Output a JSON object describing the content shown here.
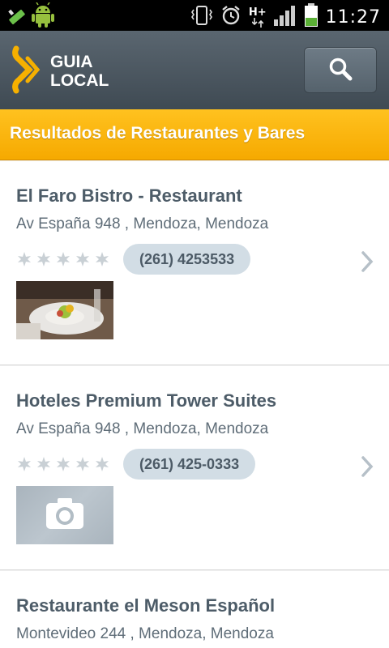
{
  "status_bar": {
    "time": "11:27",
    "network_type": "H+"
  },
  "header": {
    "logo_line1": "GUIA",
    "logo_line2": "LOCAL",
    "brand_color": "#f6a900"
  },
  "section": {
    "title": "Resultados de Restaurantes y Bares"
  },
  "results": [
    {
      "name": "El Faro Bistro - Restaurant",
      "address": "Av España 948 ,  Mendoza, Mendoza",
      "rating": 0,
      "phone": "(261) 4253533",
      "thumbnail": "food-photo"
    },
    {
      "name": "Hoteles Premium Tower Suites",
      "address": "Av España 948 ,  Mendoza, Mendoza",
      "rating": 0,
      "phone": "(261) 425-0333",
      "thumbnail": "camera-placeholder-icon"
    },
    {
      "name": "Restaurante el Meson Español",
      "address": "Montevideo 244 ,  Mendoza, Mendoza"
    }
  ]
}
